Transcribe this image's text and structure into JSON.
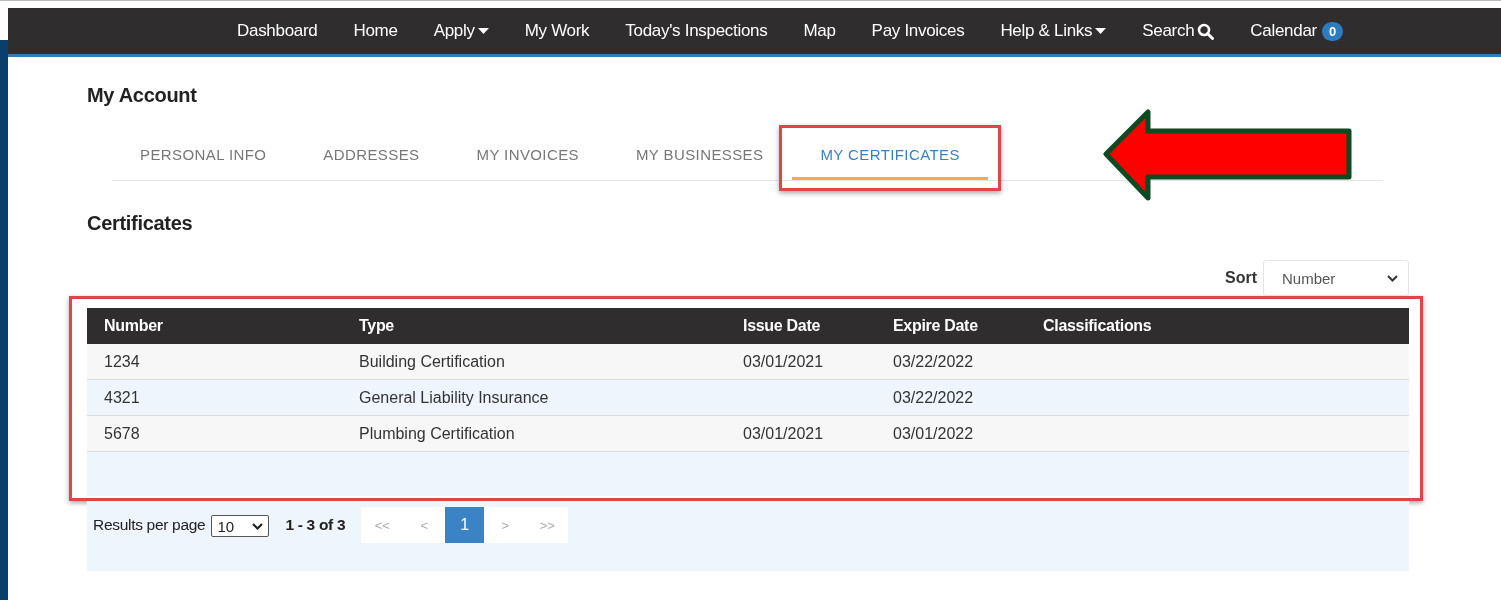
{
  "navbar": {
    "items": [
      {
        "label": "Dashboard",
        "kind": "link"
      },
      {
        "label": "Home",
        "kind": "link"
      },
      {
        "label": "Apply",
        "kind": "dropdown"
      },
      {
        "label": "My Work",
        "kind": "link"
      },
      {
        "label": "Today's Inspections",
        "kind": "link"
      },
      {
        "label": "Map",
        "kind": "link"
      },
      {
        "label": "Pay Invoices",
        "kind": "link"
      },
      {
        "label": "Help & Links",
        "kind": "dropdown"
      },
      {
        "label": "Search",
        "kind": "search"
      },
      {
        "label": "Calendar",
        "kind": "badge",
        "badge": "0"
      }
    ]
  },
  "page_title": "My Account",
  "tabs": [
    {
      "label": "PERSONAL INFO",
      "selected": false
    },
    {
      "label": "ADDRESSES",
      "selected": false
    },
    {
      "label": "MY INVOICES",
      "selected": false
    },
    {
      "label": "MY BUSINESSES",
      "selected": false
    },
    {
      "label": "MY CERTIFICATES",
      "selected": true,
      "highlighted": true
    }
  ],
  "section_title": "Certificates",
  "sort": {
    "label": "Sort",
    "value": "Number"
  },
  "table": {
    "highlighted": true,
    "columns": [
      "Number",
      "Type",
      "Issue Date",
      "Expire Date",
      "Classifications"
    ],
    "rows": [
      {
        "cells": [
          "1234",
          "Building Certification",
          "03/01/2021",
          "03/22/2022",
          null
        ]
      },
      {
        "cells": [
          "4321",
          "General Liability Insurance",
          null,
          "03/22/2022",
          null
        ]
      },
      {
        "cells": [
          "5678",
          "Plumbing Certification",
          "03/01/2021",
          "03/01/2022",
          null
        ]
      }
    ]
  },
  "pagination": {
    "results_label": "Results per page",
    "per_page": "10",
    "range": "1 - 3 of 3",
    "pages": [
      {
        "label": "<<",
        "selected": false
      },
      {
        "label": "<",
        "selected": false
      },
      {
        "label": "1",
        "selected": true
      },
      {
        "label": ">",
        "selected": false
      },
      {
        "label": ">>",
        "selected": false
      }
    ]
  },
  "annotations": [
    {
      "kind": "arrow"
    }
  ]
}
